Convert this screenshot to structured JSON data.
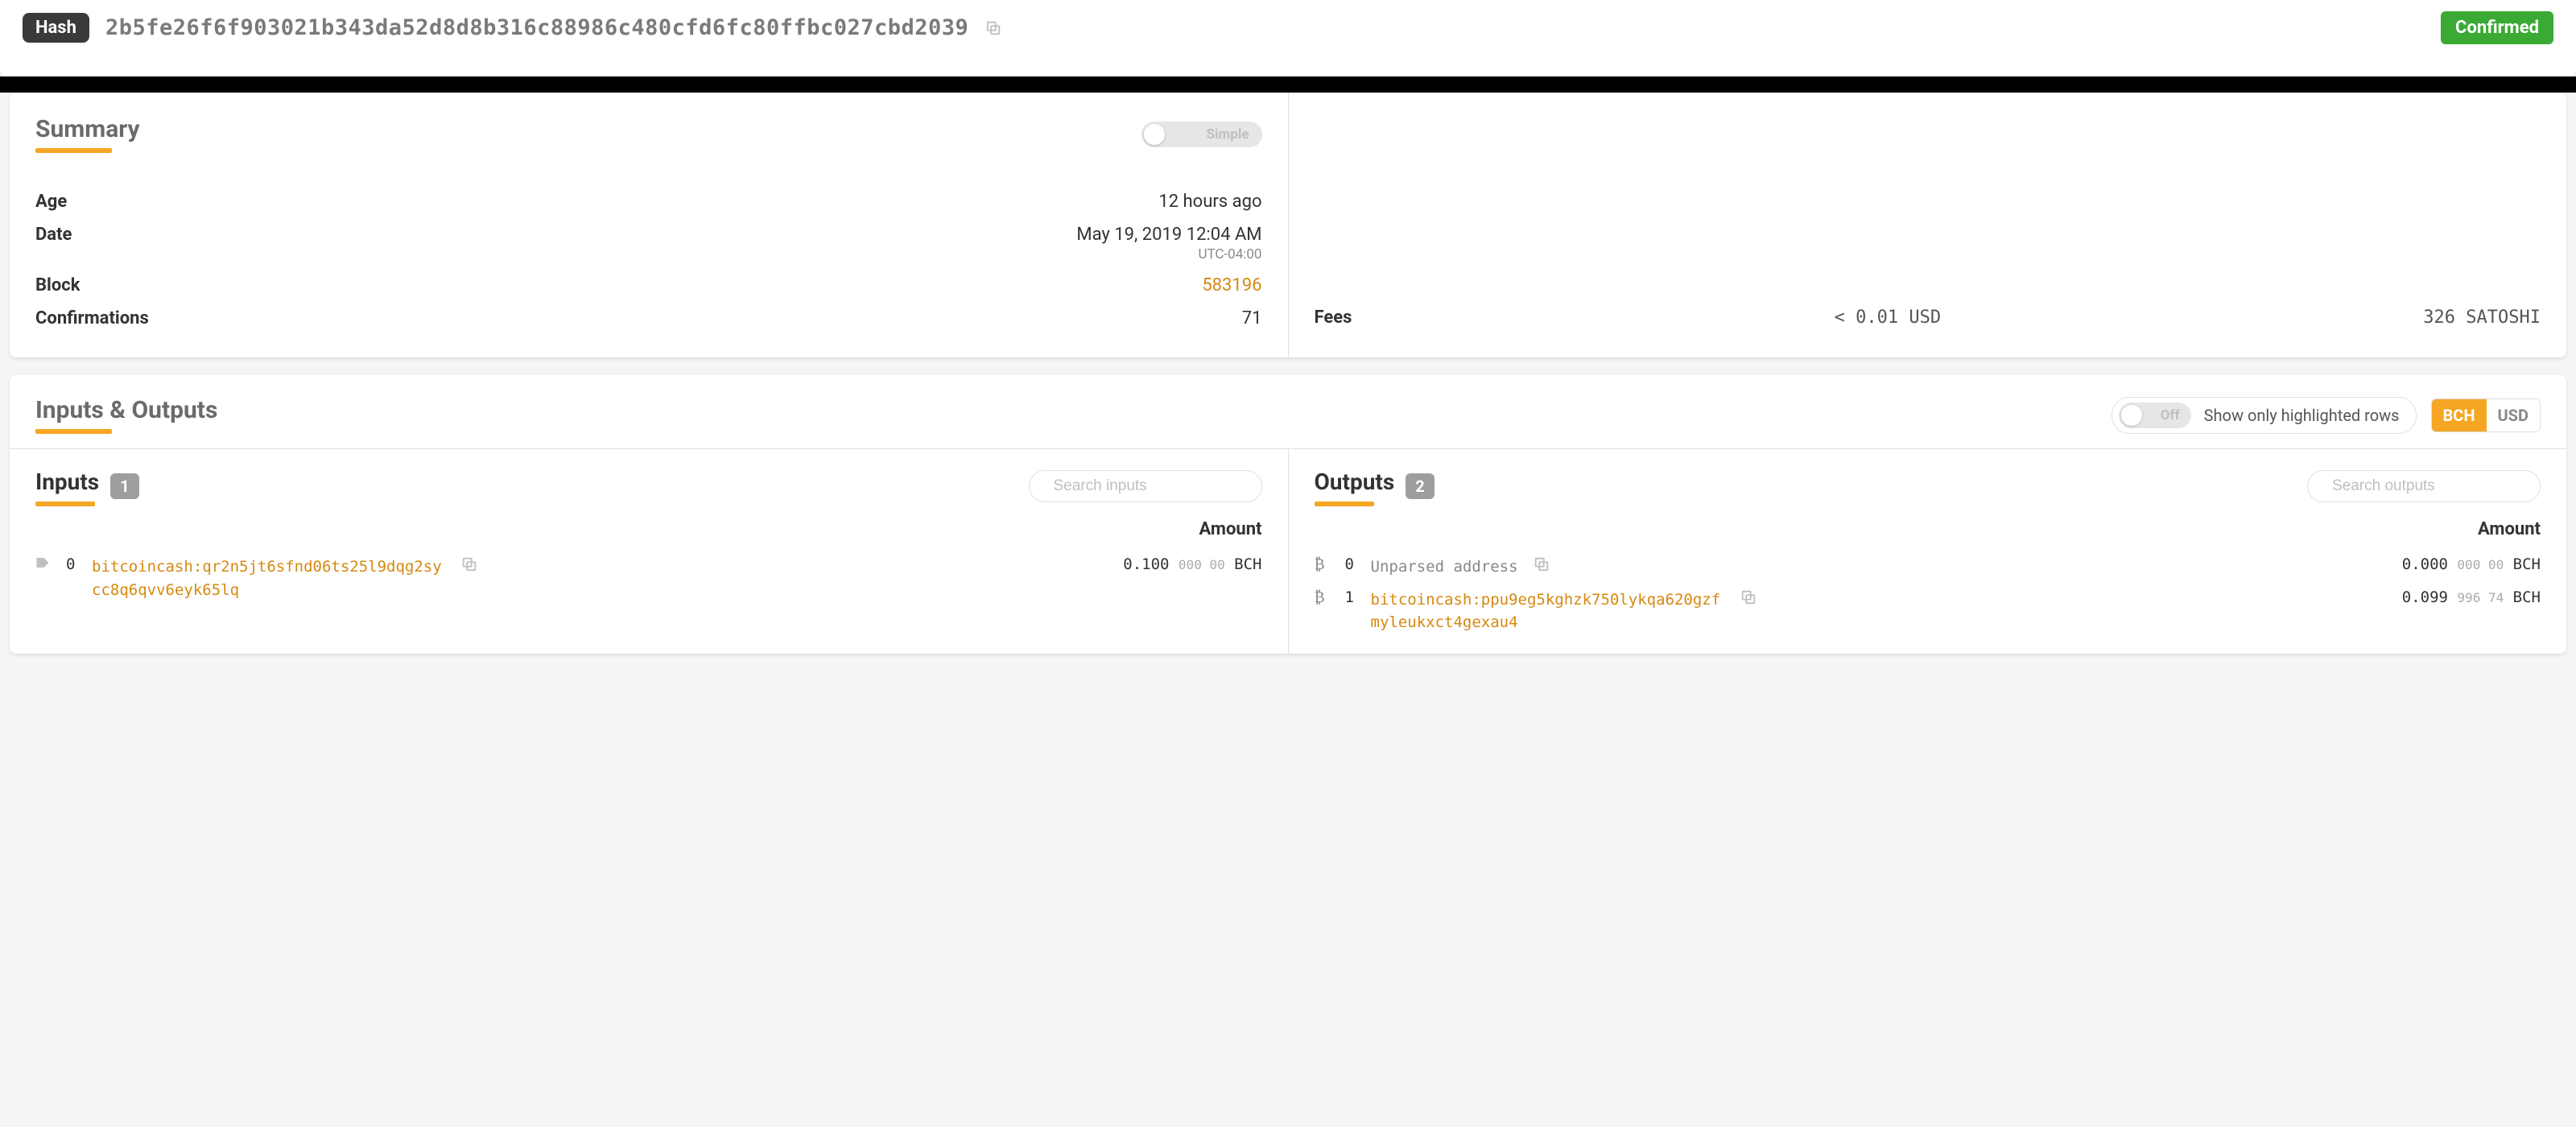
{
  "hash": {
    "label": "Hash",
    "value": "2b5fe26f6f903021b343da52d8d8b316c88986c480cfd6fc80ffbc027cbd2039",
    "status": "Confirmed"
  },
  "summary": {
    "title": "Summary",
    "toggle_label": "Simple",
    "rows": {
      "age": {
        "label": "Age",
        "value": "12 hours ago"
      },
      "date": {
        "label": "Date",
        "value": "May 19, 2019 12:04 AM",
        "sub": "UTC-04:00"
      },
      "block": {
        "label": "Block",
        "value": "583196"
      },
      "confirmations": {
        "label": "Confirmations",
        "value": "71"
      }
    }
  },
  "fees": {
    "label": "Fees",
    "usd": "< 0.01 USD",
    "satoshi": "326 SATOSHI"
  },
  "io": {
    "title": "Inputs & Outputs",
    "highlight_toggle_label": "Off",
    "highlight_text": "Show only highlighted rows",
    "currency": {
      "bch": "BCH",
      "usd": "USD"
    },
    "inputs": {
      "title": "Inputs",
      "count": "1",
      "search_placeholder": "Search inputs",
      "amount_header": "Amount",
      "rows": [
        {
          "index": "0",
          "address": "bitcoincash:qr2n5jt6sfnd06ts25l9dqg2sycc8q6qvv6eyk65lq",
          "amount_main": "0.100",
          "amount_dec": "000 00",
          "unit": "BCH"
        }
      ]
    },
    "outputs": {
      "title": "Outputs",
      "count": "2",
      "search_placeholder": "Search outputs",
      "amount_header": "Amount",
      "rows": [
        {
          "index": "0",
          "address": "Unparsed address",
          "unparsed": true,
          "amount_main": "0.000",
          "amount_dec": "000 00",
          "unit": "BCH"
        },
        {
          "index": "1",
          "address": "bitcoincash:ppu9eg5kghzk750lykqa620gzfmyleukxct4gexau4",
          "amount_main": "0.099",
          "amount_dec": "996 74",
          "unit": "BCH"
        }
      ]
    }
  }
}
